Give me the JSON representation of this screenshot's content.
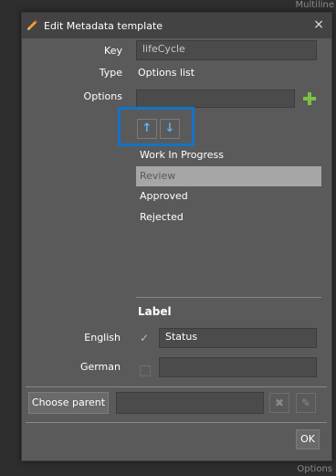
{
  "background": {
    "top_text": "Multiline",
    "bottom_text": "Options"
  },
  "dialog": {
    "title": "Edit Metadata template",
    "close_symbol": "×",
    "key": {
      "label": "Key",
      "value": "lifeCycle"
    },
    "type": {
      "label": "Type",
      "value": "Options list"
    },
    "options": {
      "label": "Options",
      "input_value": "",
      "add_icon": "plus-icon",
      "up_arrow": "↑",
      "down_arrow": "↓",
      "items": [
        {
          "label": "Work In Progress",
          "selected": false
        },
        {
          "label": "Review",
          "selected": true
        },
        {
          "label": "Approved",
          "selected": false
        },
        {
          "label": "Rejected",
          "selected": false
        }
      ]
    },
    "label_section": {
      "title": "Label",
      "languages": [
        {
          "language": "English",
          "checked": true,
          "value": "Status"
        },
        {
          "language": "German",
          "checked": false,
          "value": ""
        }
      ]
    },
    "footer": {
      "choose_parent_label": "Choose parent",
      "parent_value": "",
      "ok_label": "OK"
    }
  },
  "colors": {
    "accent_highlight": "#1473c7",
    "add_green": "#7bc242",
    "selected_row": "#a6a6a6"
  }
}
